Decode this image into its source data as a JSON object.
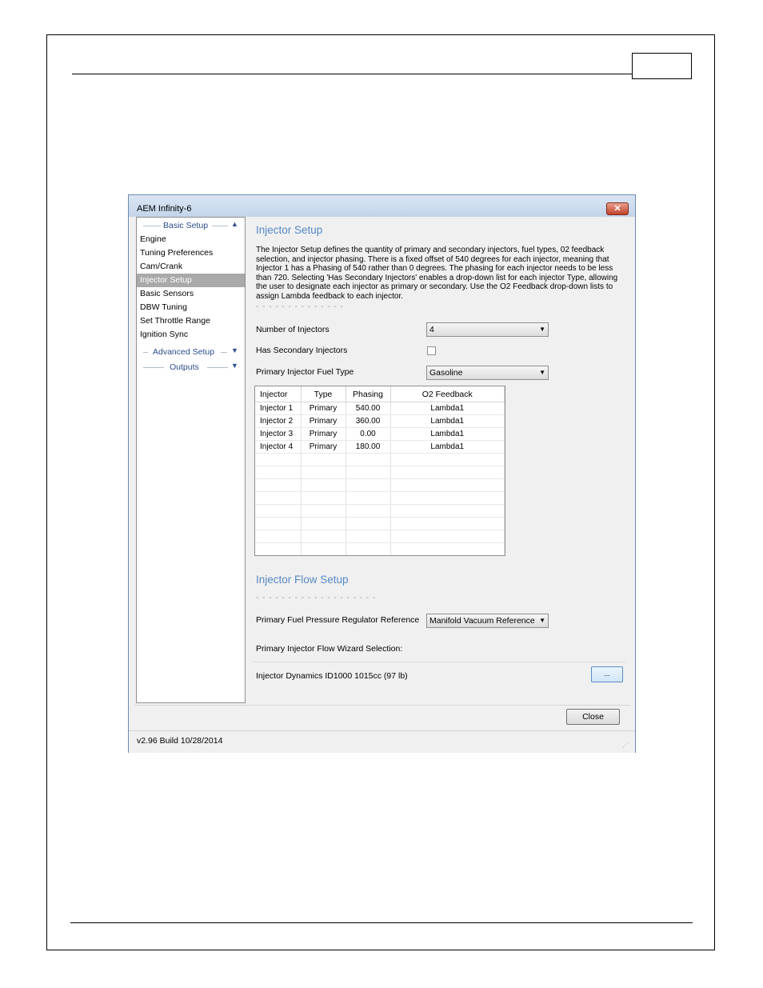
{
  "window": {
    "title": "AEM Infinity-6",
    "close_glyph": "✕",
    "version": "v2.96 Build 10/28/2014"
  },
  "sidebar": {
    "basic_setup": "Basic Setup",
    "items": [
      {
        "label": "Engine"
      },
      {
        "label": "Tuning Preferences"
      },
      {
        "label": "Cam/Crank"
      },
      {
        "label": "Injector Setup"
      },
      {
        "label": "Basic Sensors"
      },
      {
        "label": "DBW Tuning"
      },
      {
        "label": "Set Throttle Range"
      },
      {
        "label": "Ignition Sync"
      }
    ],
    "advanced_setup": "Advanced Setup",
    "outputs": "Outputs",
    "chevron_up": "▲",
    "chevron_down": "▼"
  },
  "injector_setup": {
    "heading": "Injector Setup",
    "description": "The Injector Setup defines the quantity of primary and secondary injectors, fuel types, 02 feedback selection, and injector phasing. There is a fixed offset of 540 degrees for each injector, meaning that Injector 1 has a Phasing of 540 rather than 0 degrees. The phasing for each injector needs to be less than 720. Selecting 'Has Secondary Injectors' enables a drop-down list for each injector Type, allowing the user to designate each injector as primary or secondary. Use the O2 Feedback drop-down lists to assign Lambda feedback to each injector.",
    "divider": "- - - - - - - - - - - - - -",
    "num_injectors_label": "Number of Injectors",
    "num_injectors_value": "4",
    "has_secondary_label": "Has Secondary Injectors",
    "fuel_type_label": "Primary Injector Fuel Type",
    "fuel_type_value": "Gasoline",
    "table": {
      "headers": [
        "Injector",
        "Type",
        "Phasing",
        "O2 Feedback"
      ],
      "rows": [
        [
          "Injector 1",
          "Primary",
          "540.00",
          "Lambda1"
        ],
        [
          "Injector 2",
          "Primary",
          "360.00",
          "Lambda1"
        ],
        [
          "Injector 3",
          "Primary",
          "0.00",
          "Lambda1"
        ],
        [
          "Injector 4",
          "Primary",
          "180.00",
          "Lambda1"
        ]
      ]
    }
  },
  "flow_setup": {
    "heading": "Injector Flow Setup",
    "divider": "- - - - - - - - - - - - - - - - - - -",
    "regulator_label": "Primary Fuel Pressure Regulator Reference",
    "regulator_value": "Manifold Vacuum Reference",
    "wizard_label": "Primary Injector Flow Wizard Selection:",
    "wizard_value": "Injector Dynamics ID1000 1015cc (97 lb)",
    "browse_label": "...",
    "dropdown_arrow": "▼"
  },
  "footer": {
    "close_label": "Close",
    "grip": "⋰"
  }
}
